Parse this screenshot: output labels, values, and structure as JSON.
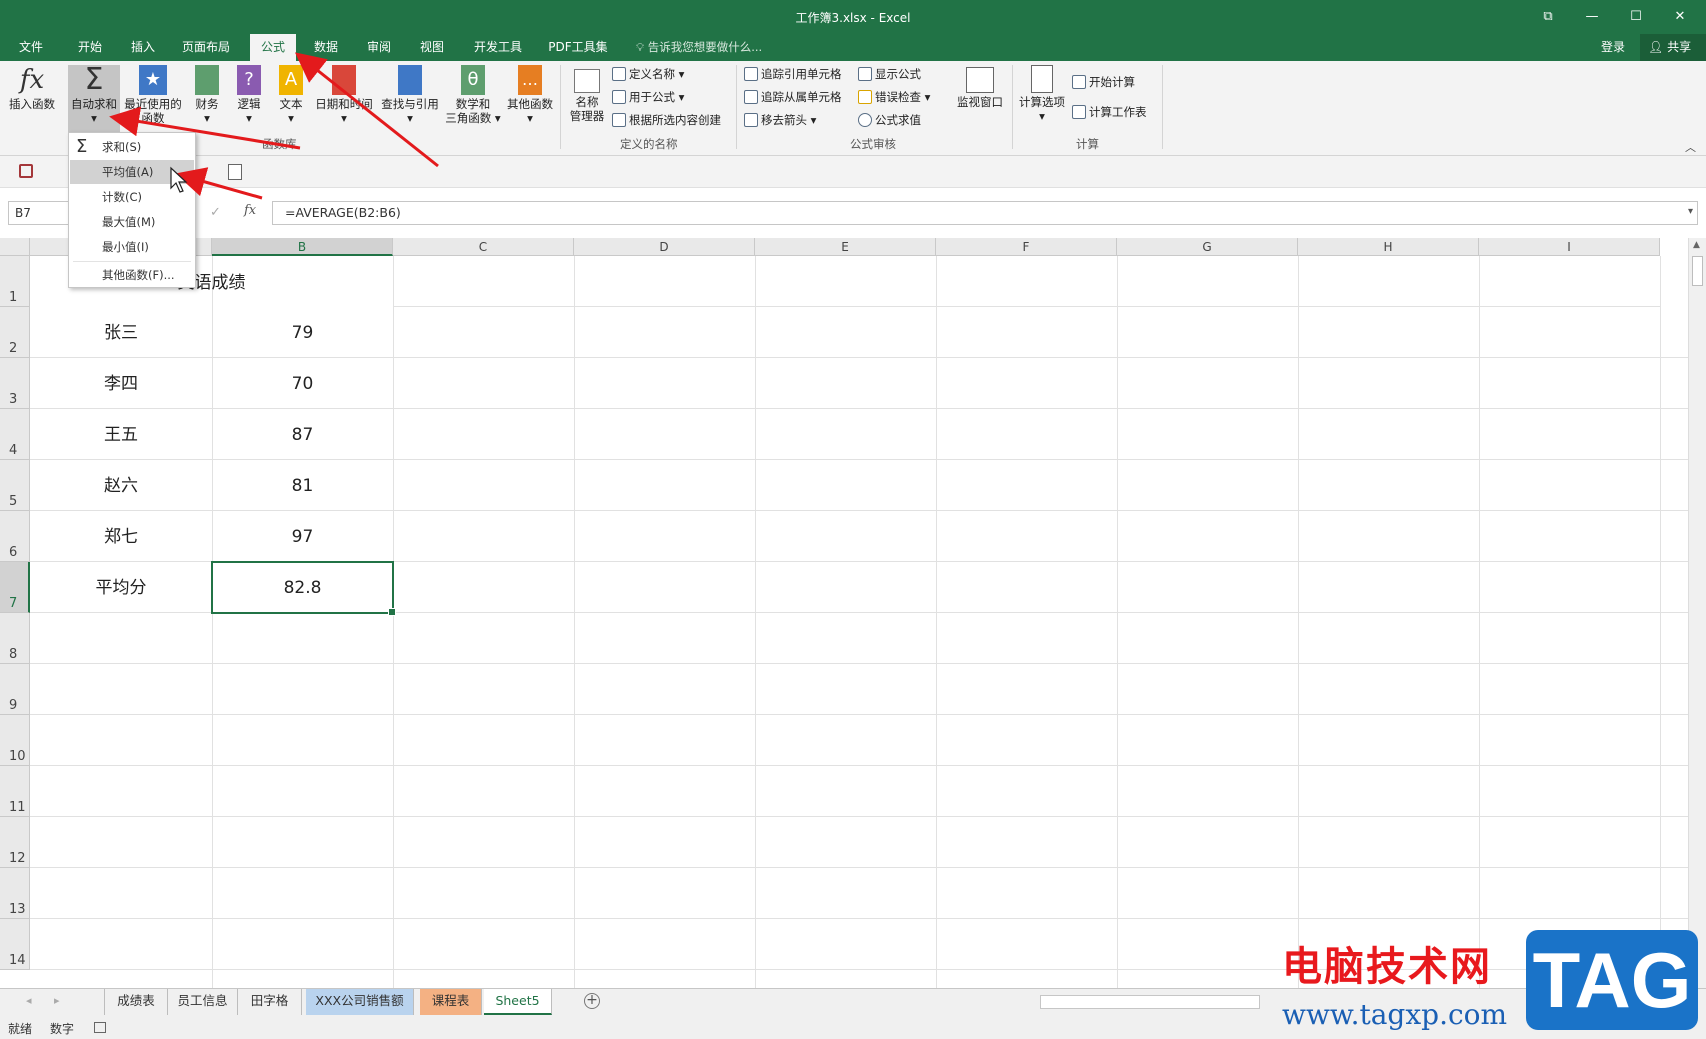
{
  "window": {
    "title": "工作簿3.xlsx - Excel"
  },
  "tabs": [
    "文件",
    "开始",
    "插入",
    "页面布局",
    "公式",
    "数据",
    "审阅",
    "视图",
    "开发工具",
    "PDF工具集"
  ],
  "tell_me": "告诉我您想要做什么...",
  "login": "登录",
  "share": "共享",
  "ribbon": {
    "insert_function": "插入函数",
    "autosum": "自动求和",
    "recent_line1": "最近使用的",
    "recent_line2": "函数",
    "financial": "财务",
    "logical": "逻辑",
    "text": "文本",
    "datetime": "日期和时间",
    "lookup": "查找与引用",
    "math_line1": "数学和",
    "math_line2": "三角函数",
    "more": "其他函数",
    "group_library": "函数库",
    "name_mgr_line1": "名称",
    "name_mgr_line2": "管理器",
    "define_name": "定义名称",
    "use_in_formula": "用于公式",
    "create_from_selection": "根据所选内容创建",
    "group_names": "定义的名称",
    "trace_precedents": "追踪引用单元格",
    "trace_dependents": "追踪从属单元格",
    "remove_arrows": "移去箭头",
    "show_formulas": "显示公式",
    "error_checking": "错误检查",
    "evaluate_formula": "公式求值",
    "group_auditing": "公式审核",
    "watch_window": "监视窗口",
    "calc_options": "计算选项",
    "calc_now": "开始计算",
    "calc_sheet": "计算工作表",
    "group_calc": "计算"
  },
  "dropdown": {
    "items": [
      "求和(S)",
      "平均值(A)",
      "计数(C)",
      "最大值(M)",
      "最小值(I)",
      "其他函数(F)..."
    ]
  },
  "formula_bar": {
    "name_box": "B7",
    "formula": "=AVERAGE(B2:B6)"
  },
  "columns": [
    "B",
    "C",
    "D",
    "E",
    "F",
    "G",
    "H",
    "I"
  ],
  "rows": [
    "1",
    "2",
    "3",
    "4",
    "5",
    "6",
    "7",
    "8",
    "9",
    "10",
    "11",
    "12",
    "13",
    "14"
  ],
  "cells": {
    "title": "英语成绩",
    "names": [
      "张三",
      "李四",
      "王五",
      "赵六",
      "郑七",
      "平均分"
    ],
    "scores": [
      "79",
      "70",
      "87",
      "81",
      "97",
      "82.8"
    ]
  },
  "sheets": [
    "成绩表",
    "员工信息",
    "田字格",
    "XXX公司销售额",
    "课程表",
    "Sheet5"
  ],
  "status": {
    "ready": "就绪",
    "numlock": "数字"
  },
  "watermark": {
    "site_name": "电脑技术网",
    "url": "www.tagxp.com",
    "tag": "TAG"
  },
  "colors": {
    "excel_green": "#217346",
    "arrow_red": "#e31a1c"
  }
}
